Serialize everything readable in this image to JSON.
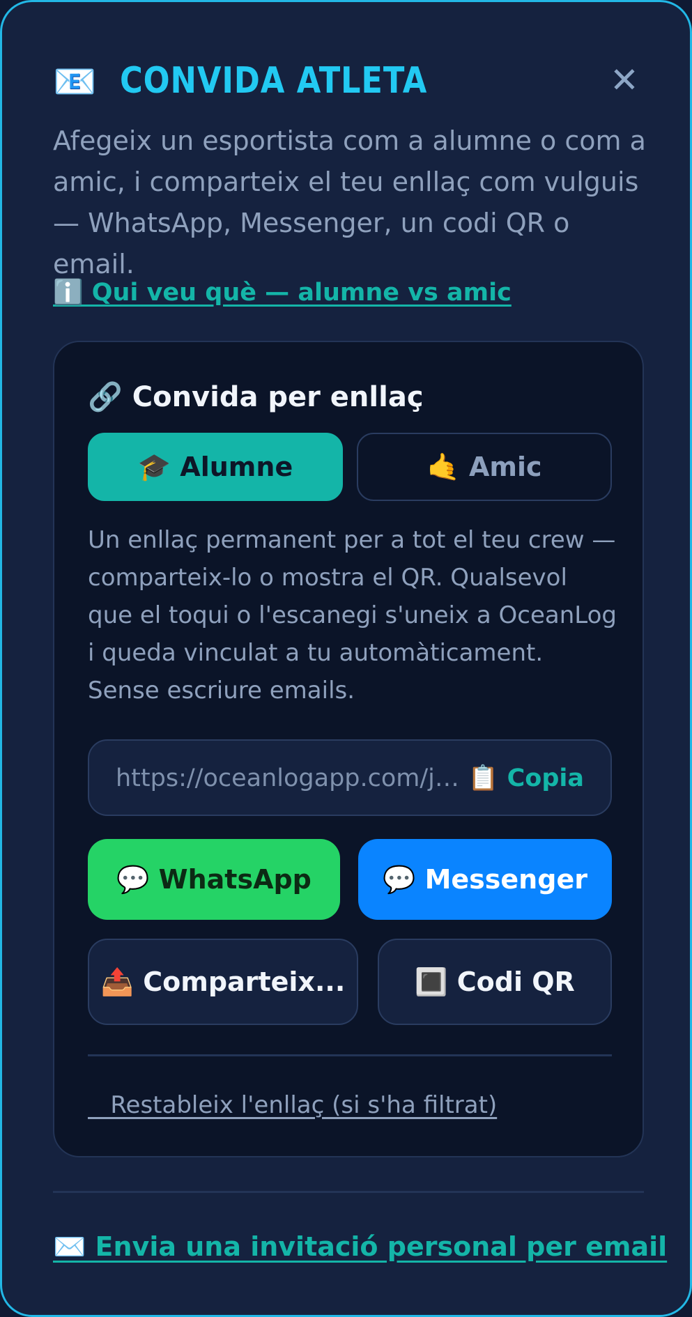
{
  "modal": {
    "title_icon": "📧",
    "title": "CONVIDA ATLETA",
    "close_icon": "✕",
    "subtitle": "Afegeix un esportista com a alumne o com a amic, i comparteix el teu enllaç com vulguis — WhatsApp, Messenger, un codi QR o email.",
    "info_link": "ℹ️ Qui veu què — alumne vs amic"
  },
  "invite_card": {
    "title": "🔗 Convida per enllaç",
    "toggle": {
      "alumne_label": "🎓 Alumne",
      "amic_label": "🤙 Amic",
      "selected": "Alumne"
    },
    "description": "Un enllaç permanent per a tot el teu crew — comparteix-lo o mostra el QR. Qualsevol que el toqui o l'escanegi s'uneix a OceanLog i queda vinculat a tu automàticament. Sense escriure emails.",
    "link_value": "https://oceanlogapp.com/jo...",
    "copy_label": "📋 Copia",
    "whatsapp_label": "💬 WhatsApp",
    "messenger_label": "💬 Messenger",
    "share_label": "📤 Comparteix...",
    "qr_label": "🔳 Codi QR",
    "reset_label": "   Restableix l'enllaç (si s'ha filtrat)"
  },
  "email_invite_link": "✉️ Envia una invitació personal per email",
  "colors": {
    "accent": "#14b5a8",
    "title": "#22c9f2",
    "whatsapp": "#25d366",
    "messenger": "#0a84ff",
    "border": "#22b8e6"
  }
}
